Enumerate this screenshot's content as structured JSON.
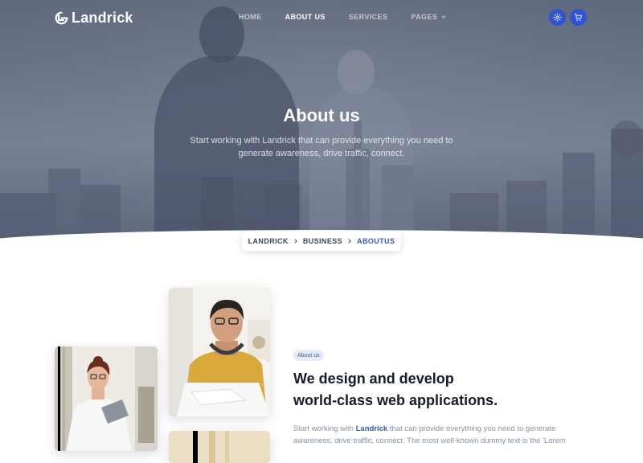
{
  "brand": {
    "name": "Landrick"
  },
  "nav": {
    "items": [
      {
        "label": "HOME",
        "active": false
      },
      {
        "label": "ABOUT US",
        "active": true
      },
      {
        "label": "SERVICES",
        "active": false
      },
      {
        "label": "PAGES",
        "active": false,
        "dropdown": true
      }
    ],
    "buttons": [
      {
        "icon": "gear-icon"
      },
      {
        "icon": "cart-icon"
      }
    ]
  },
  "hero": {
    "title": "About us",
    "subtitle": "Start working with Landrick that can provide everything you need to generate awareness, drive traffic, connect."
  },
  "breadcrumb": {
    "items": [
      "LANDRICK",
      "BUSINESS",
      "ABOUTUS"
    ]
  },
  "about": {
    "badge": "About us",
    "title_line1": "We design and develop",
    "title_line2": "world-class web applications.",
    "text_before": "Start working with ",
    "text_highlight": "Landrick",
    "text_after": " that can provide everything you need to generate awareness, drive traffic, connect. The most well-known dummy text is the 'Lorem"
  },
  "colors": {
    "primary": "#2f55d4",
    "heading": "#161c2d",
    "muted": "#8492a6"
  }
}
